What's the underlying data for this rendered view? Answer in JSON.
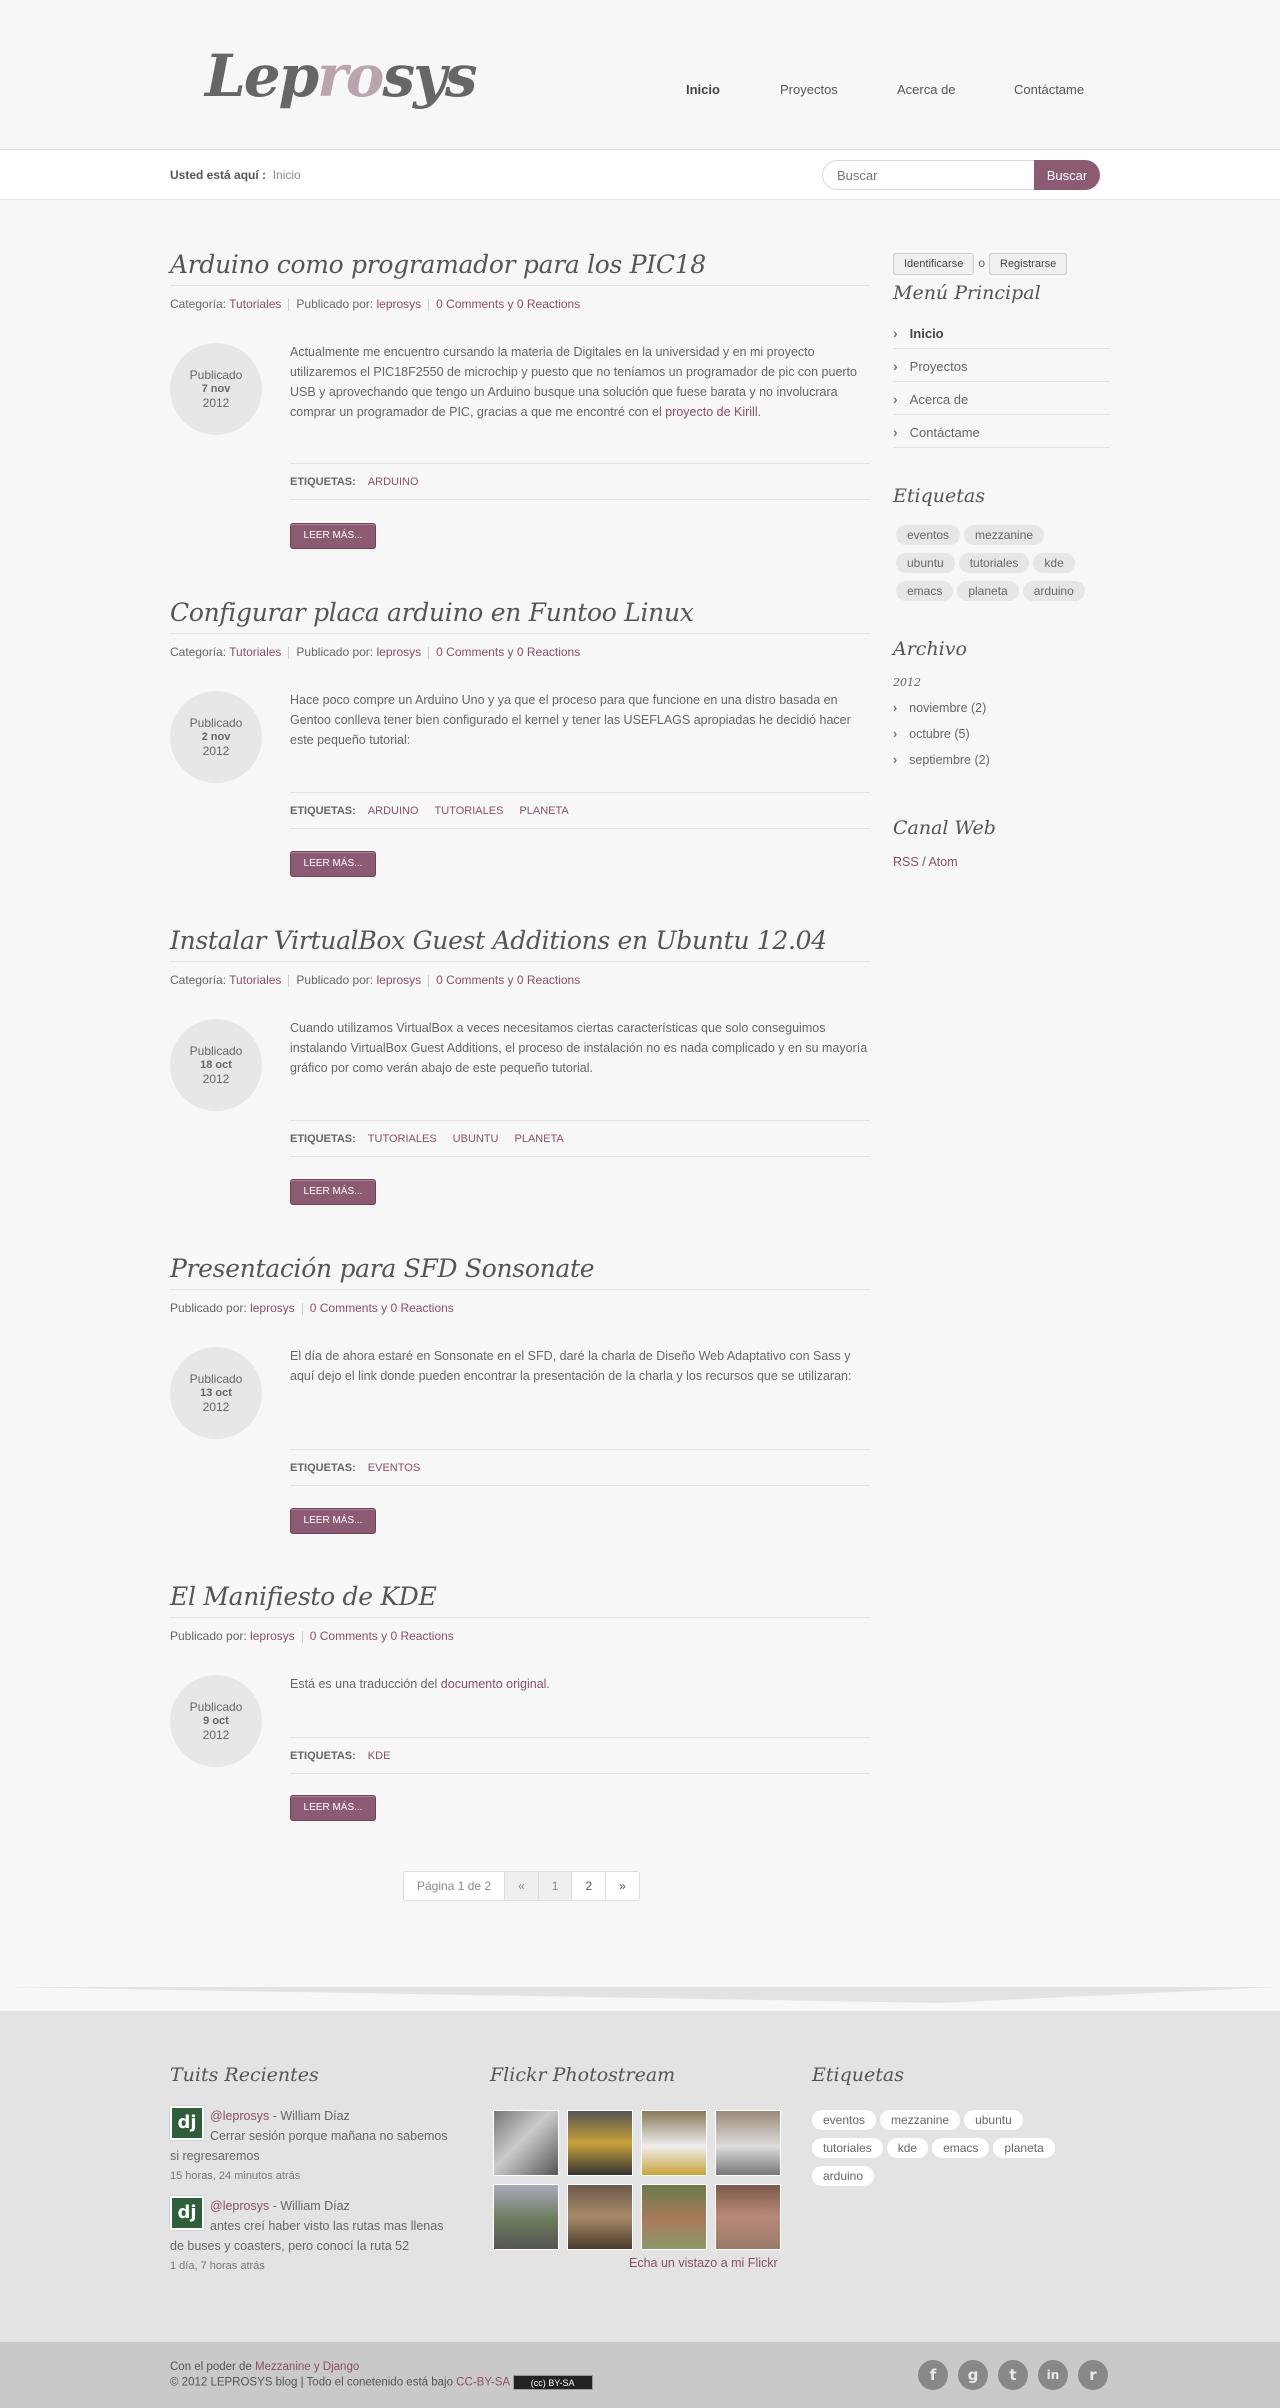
{
  "brand": {
    "logo_pre": "Lep",
    "logo_mid": "ro",
    "logo_post": "sys"
  },
  "nav": [
    {
      "label": "Inicio"
    },
    {
      "label": "Proyectos"
    },
    {
      "label": "Acerca de"
    },
    {
      "label": "Contáctame"
    }
  ],
  "breadcrumb": {
    "prefix": "Usted está aquí :",
    "current": "Inicio"
  },
  "search": {
    "placeholder": "Buscar",
    "button": "Buscar"
  },
  "posts": [
    {
      "title": "Arduino como programador para los PIC18",
      "category_label": "Categoría:",
      "category": "Tutoriales",
      "author_label": "Publicado por:",
      "author": "leprosys",
      "comments": "0 Comments y 0 Reactions",
      "date_label": "Publicado",
      "date_day": "7 nov",
      "date_year": "2012",
      "excerpt": "Actualmente me encuentro cursando la materia de Digitales en la universidad y en mi proyecto utilizaremos el PIC18F2550 de microchip y puesto que no teníamos un programador de pic con puerto USB y aprovechando que tengo un Arduino busque una solución que fuese barata y no involucrara comprar un programador de PIC, gracias a que me encontré con el ",
      "excerpt_link": "proyecto de Kirill",
      "excerpt_end": ".",
      "tags_label": "ETIQUETAS:",
      "tags": [
        "ARDUINO"
      ],
      "readmore": "LEER MÁS..."
    },
    {
      "title": "Configurar placa arduino en Funtoo Linux",
      "category_label": "Categoría:",
      "category": "Tutoriales",
      "author_label": "Publicado por:",
      "author": "leprosys",
      "comments": "0 Comments y 0 Reactions",
      "date_label": "Publicado",
      "date_day": "2 nov",
      "date_year": "2012",
      "excerpt": "Hace poco compre un Arduino Uno y ya que el proceso para que funcione en una distro basada en Gentoo conlleva tener bien configurado el kernel y tener las USEFLAGS apropiadas he decidió hacer este pequeño tutorial:",
      "tags_label": "ETIQUETAS:",
      "tags": [
        "ARDUINO",
        "TUTORIALES",
        "PLANETA"
      ],
      "readmore": "LEER MÁS..."
    },
    {
      "title": "Instalar VirtualBox Guest Additions en Ubuntu 12.04",
      "category_label": "Categoría:",
      "category": "Tutoriales",
      "author_label": "Publicado por:",
      "author": "leprosys",
      "comments": "0 Comments y 0 Reactions",
      "date_label": "Publicado",
      "date_day": "18 oct",
      "date_year": "2012",
      "excerpt": "Cuando utilizamos VirtualBox a veces necesitamos ciertas características que solo conseguimos instalando VirtualBox Guest Additions, el proceso de instalación no es nada complicado y en su mayoría gráfico por como verán abajo de este pequeño tutorial.",
      "tags_label": "ETIQUETAS:",
      "tags": [
        "TUTORIALES",
        "UBUNTU",
        "PLANETA"
      ],
      "readmore": "LEER MÁS..."
    },
    {
      "title": "Presentación para SFD Sonsonate",
      "author_label": "Publicado por:",
      "author": "leprosys",
      "comments": "0 Comments y 0 Reactions",
      "date_label": "Publicado",
      "date_day": "13 oct",
      "date_year": "2012",
      "excerpt": "El día de ahora estaré en Sonsonate en el SFD, daré la charla de Diseño Web Adaptativo con Sass y aquí dejo el link donde pueden encontrar la presentación de la charla y los recursos que se utilizaran:",
      "tags_label": "ETIQUETAS:",
      "tags": [
        "EVENTOS"
      ],
      "readmore": "LEER MÁS..."
    },
    {
      "title": "El Manifiesto de KDE",
      "author_label": "Publicado por:",
      "author": "leprosys",
      "comments": "0 Comments y 0 Reactions",
      "date_label": "Publicado",
      "date_day": "9 oct",
      "date_year": "2012",
      "excerpt": "Está es una traducción del ",
      "excerpt_link": "documento original",
      "excerpt_end": ".",
      "tags_label": "ETIQUETAS:",
      "tags": [
        "KDE"
      ],
      "readmore": "LEER MÁS..."
    }
  ],
  "pagination": {
    "info": "Página 1 de 2",
    "prev": "«",
    "pages": [
      "1",
      "2"
    ],
    "next": "»"
  },
  "sidebar": {
    "login": "Identificarse",
    "or": "o",
    "register": "Registrarse",
    "menu_title": "Menú Principal",
    "menu": [
      "Inicio",
      "Proyectos",
      "Acerca de",
      "Contáctame"
    ],
    "tags_title": "Etiquetas",
    "tags": [
      "eventos",
      "mezzanine",
      "ubuntu",
      "tutoriales",
      "kde",
      "emacs",
      "planeta",
      "arduino"
    ],
    "archive_title": "Archivo",
    "archive_year": "2012",
    "archive": [
      "noviembre (2)",
      "octubre (5)",
      "septiembre (2)"
    ],
    "feed_title": "Canal Web",
    "feed_rss": "RSS",
    "feed_sep": "/",
    "feed_atom": "Atom"
  },
  "footer": {
    "tweets_title": "Tuits Recientes",
    "tweets": [
      {
        "handle": "@leprosys",
        "name": " - William Díaz",
        "text": "Cerrar sesión porque mañana no sabemos si regresaremos",
        "time": "15 horas, 24 minutos atrás"
      },
      {
        "handle": "@leprosys",
        "name": " - William Díaz",
        "text": "antes creí haber visto las rutas mas llenas de buses y coasters, pero conocí la ruta 52",
        "time": "1 día, 7 horas atrás"
      }
    ],
    "flickr_title": "Flickr Photostream",
    "flickr_link": "Echa un vistazo a mi Flickr",
    "tags_title": "Etiquetas",
    "tags": [
      "eventos",
      "mezzanine",
      "ubuntu",
      "tutoriales",
      "kde",
      "emacs",
      "planeta",
      "arduino"
    ],
    "powered_prefix": "Con el poder de ",
    "powered_link": "Mezzanine y Django",
    "copyright": "© 2012 LEPROSYS blog | Todo el conetenido está bajo ",
    "license_link": "CC-BY-SA",
    "license_badge": "(cc) BY-SA"
  },
  "social": [
    {
      "icon": "facebook-icon",
      "glyph": "f"
    },
    {
      "icon": "google-icon",
      "glyph": "g"
    },
    {
      "icon": "twitter-icon",
      "glyph": "t"
    },
    {
      "icon": "linkedin-icon",
      "glyph": "in"
    },
    {
      "icon": "rss-icon",
      "glyph": "r"
    }
  ],
  "colors": {
    "accent": "#8d5a74",
    "link": "#8a4f6a",
    "footer_bg": "#e3e3e3",
    "bottom_bg": "#c9c9c9"
  }
}
